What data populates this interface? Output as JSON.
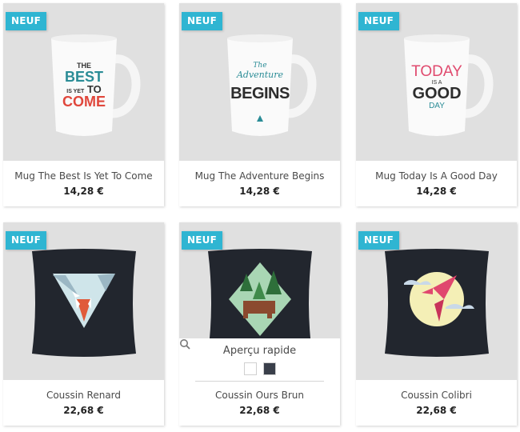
{
  "products": [
    {
      "name": "Mug The Best Is Yet To Come",
      "price": "14,28 €",
      "badge": "NEUF"
    },
    {
      "name": "Mug The Adventure Begins",
      "price": "14,28 €",
      "badge": "NEUF"
    },
    {
      "name": "Mug Today Is A Good Day",
      "price": "14,28 €",
      "badge": "NEUF"
    },
    {
      "name": "Coussin Renard",
      "price": "22,68 €",
      "badge": "NEUF"
    },
    {
      "name": "Coussin Ours Brun",
      "price": "22,68 €",
      "badge": "NEUF"
    },
    {
      "name": "Coussin Colibri",
      "price": "22,68 €",
      "badge": "NEUF"
    }
  ],
  "quick_view": {
    "label": "Aperçu rapide",
    "icon": "search-icon"
  },
  "mug_prints": {
    "best": [
      "THE",
      "BEST",
      "IS YET",
      "TO",
      "COME"
    ],
    "adventure": [
      "The",
      "Adventure",
      "BEGINS"
    ],
    "today": [
      "TODAY",
      "IS A",
      "GOOD",
      "DAY"
    ]
  },
  "swatch_colors": [
    "#ffffff",
    "#3a3f4a"
  ],
  "colors": {
    "badge": "#2fb5d2",
    "card_bg": "#e0e0e0"
  }
}
